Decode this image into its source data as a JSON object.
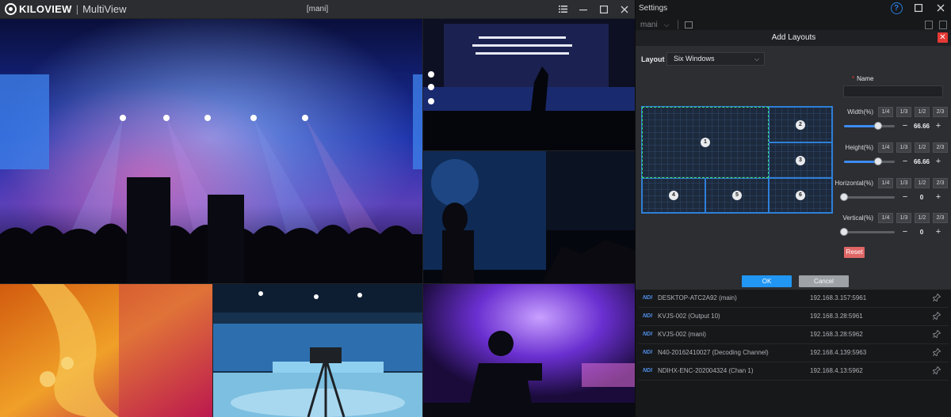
{
  "multiview": {
    "brand": "KILOVIEW",
    "app_name": "MultiView",
    "window_title": "[mani]",
    "controls": [
      "list-icon",
      "minimize-icon",
      "maximize-icon",
      "close-icon"
    ]
  },
  "settings": {
    "title": "Settings",
    "selected_device": "mani",
    "dialog": {
      "title": "Add Layouts",
      "layout_label": "Layout",
      "layout_value": "Six Windows",
      "cells": [
        "1",
        "2",
        "3",
        "4",
        "5",
        "6"
      ],
      "selected_cell": "1",
      "name_label": "Name",
      "name_required_mark": "*",
      "name_value": "",
      "params": [
        {
          "label": "Width(%)",
          "value": "66.66",
          "fraction": 0.6666
        },
        {
          "label": "Height(%)",
          "value": "66.66",
          "fraction": 0.6666
        },
        {
          "label": "Horizontal(%)",
          "value": "0",
          "fraction": 0
        },
        {
          "label": "Vertical(%)",
          "value": "0",
          "fraction": 0
        }
      ],
      "fractions": [
        "1/4",
        "1/3",
        "1/2",
        "2/3"
      ],
      "minus": "−",
      "plus": "+",
      "reset_label": "Reset",
      "ok_label": "OK",
      "cancel_label": "Cancel"
    },
    "sources": [
      {
        "tag": "NDI",
        "name": "DESKTOP-ATC2A92 (main)",
        "ip": "192.168.3.157:5961"
      },
      {
        "tag": "NDI",
        "name": "KVJS-002 (Output 10)",
        "ip": "192.168.3.28:5961"
      },
      {
        "tag": "NDI",
        "name": "KVJS-002 (mani)",
        "ip": "192.168.3.28:5962"
      },
      {
        "tag": "NDI",
        "name": "N40-20162410027 (Decoding Channel)",
        "ip": "192.168.4.139:5963"
      },
      {
        "tag": "NDI",
        "name": "NDIHX-ENC-202004324 (Chan 1)",
        "ip": "192.168.4.13:5962"
      }
    ]
  },
  "colors": {
    "accent": "#2196f3",
    "selection": "#39e36b",
    "danger": "#e53935",
    "reset": "#e06666",
    "ndi_tag": "#4e8fe8"
  }
}
